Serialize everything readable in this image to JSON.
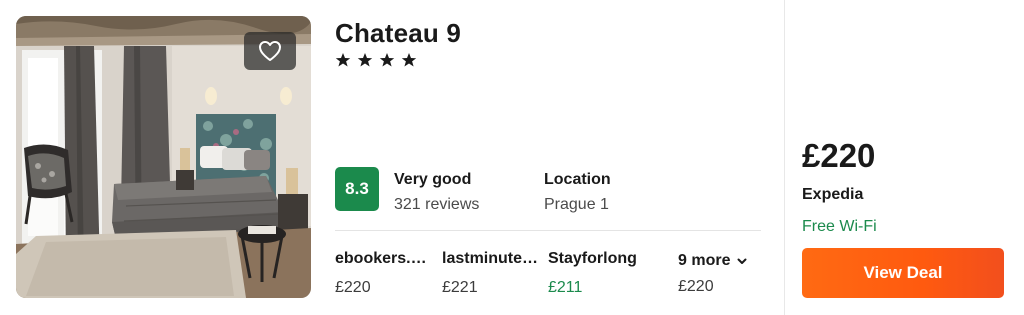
{
  "hotel": {
    "name": "Chateau 9",
    "stars": 4,
    "star_glyph": "★"
  },
  "rating": {
    "score": "8.3",
    "label": "Very good",
    "reviews": "321 reviews",
    "badge_color": "#1b8a4c"
  },
  "location": {
    "label": "Location",
    "value": "Prague 1"
  },
  "providers": [
    {
      "name": "ebookers.com",
      "price": "£220",
      "price_color": "default"
    },
    {
      "name": "lastminute.com",
      "price": "£221",
      "price_color": "default"
    },
    {
      "name": "Stayforlong",
      "price": "£211",
      "price_color": "green"
    }
  ],
  "more": {
    "label": "9 more",
    "price": "£220",
    "icon": "chevron-down-icon"
  },
  "deal": {
    "price": "£220",
    "provider": "Expedia",
    "amenity": "Free Wi-Fi",
    "button_label": "View Deal",
    "button_color": "#ff5a0f",
    "amenity_color": "#1b8a4c"
  },
  "photo": {
    "favorite_icon": "heart-icon"
  }
}
